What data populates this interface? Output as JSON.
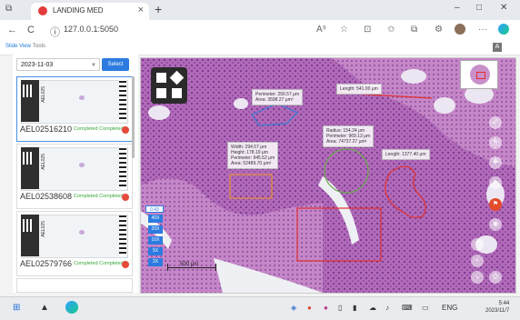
{
  "browser": {
    "tab_title": "LANDING MED",
    "tab_close": "×",
    "new_tab": "+",
    "url": "127.0.0.1:5050",
    "back_icon": "←",
    "reload_icon": "C",
    "info_icon": "ⓘ",
    "window_min": "–",
    "window_max": "□",
    "window_close": "✕",
    "read_aloud": "A⁹",
    "favorite": "☆",
    "split": "⊡",
    "favorites_bar": "✩",
    "collections": "⧉",
    "extensions": "⚙",
    "more": "···",
    "sub_tab_1": "Slide View",
    "sub_tab_2": "Tools",
    "sub_icon": "A"
  },
  "sidebar": {
    "date_value": "2023-11-03",
    "select_button": "Select",
    "slides": [
      {
        "vert_code": "AEL025",
        "id": "AEL02516210",
        "status": "Completed Completed"
      },
      {
        "vert_code": "AEL025",
        "id": "AEL02538608",
        "status": "Completed Completed"
      },
      {
        "vert_code": "AEL025",
        "id": "AEL02579766",
        "status": "Completed Completed"
      }
    ]
  },
  "viewer": {
    "annotations": {
      "pentagon": {
        "lines": [
          "Perimeter: 256.57 μm",
          "Area: 3598.27 μm²"
        ]
      },
      "line": {
        "lines": [
          "Length: 541.00 μm"
        ]
      },
      "circle": {
        "lines": [
          "Radius: 154.24 μm",
          "Perimeter: 969.13 μm",
          "Area: 74737.27 μm²"
        ]
      },
      "rectangle_small": {
        "lines": [
          "Width: 294.57 μm",
          "Height: 178.19 μm",
          "Perimeter: 945.52 μm",
          "Area: 52489.70 μm²"
        ]
      },
      "freehand": {
        "lines": [
          "Length: 1377.40 μm"
        ]
      }
    },
    "zoom_current": "0.43",
    "zoom_levels": [
      "40X",
      "20X",
      "10X",
      "5X",
      "2X"
    ],
    "scale_text": "500 μm",
    "right_tools": [
      "⤢",
      "✎",
      "✥",
      "➤",
      "⚑",
      "◉"
    ],
    "bottom_tools": [
      "⌃",
      "⌕",
      "⌄",
      "⎙"
    ],
    "colors": {
      "annotation_line": "#e03030",
      "pentagon": "#3a7bd5",
      "circle": "#6aa84f",
      "rect_small": "#e69138",
      "rect_red": "#e03030",
      "accent": "#2d7be0"
    }
  },
  "taskbar": {
    "start_icon": "⊞",
    "lang": "ENG",
    "time": "5:44",
    "date": "2023/11/7"
  }
}
